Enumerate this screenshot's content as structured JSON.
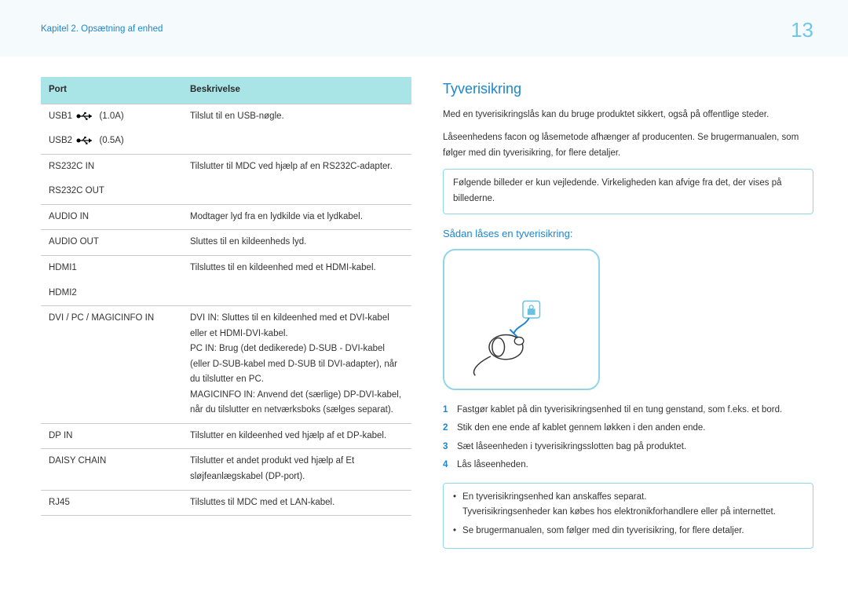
{
  "header": {
    "breadcrumb": "Kapitel 2. Opsætning af enhed",
    "page_number": "13"
  },
  "table": {
    "head_port": "Port",
    "head_desc": "Beskrivelse",
    "rows": [
      {
        "port": "USB1",
        "extra": "(1.0A)",
        "desc": "Tilslut til en USB-nøgle.",
        "icon": true
      },
      {
        "port": "USB2",
        "extra": "(0.5A)",
        "desc": "",
        "noborder": true,
        "icon": true
      },
      {
        "port": "RS232C IN",
        "desc": "Tilslutter til MDC ved hjælp af en RS232C-adapter."
      },
      {
        "port": "RS232C OUT",
        "desc": "",
        "noborder": true
      },
      {
        "port": "AUDIO IN",
        "desc": "Modtager lyd fra en lydkilde via et lydkabel."
      },
      {
        "port": "AUDIO OUT",
        "desc": "Sluttes til en kildeenheds lyd."
      },
      {
        "port": "HDMI1",
        "desc": "Tilsluttes til en kildeenhed med et HDMI-kabel."
      },
      {
        "port": "HDMI2",
        "desc": "",
        "noborder": true
      },
      {
        "port": "DVI / PC / MAGICINFO IN",
        "desc": "DVI IN: Sluttes til en kildeenhed med et DVI-kabel eller et HDMI-DVI-kabel.\nPC IN: Brug (det dedikerede) D-SUB - DVI-kabel (eller D-SUB-kabel med D-SUB til DVI-adapter), når du tilslutter en PC.\nMAGICINFO IN: Anvend det (særlige) DP-DVI-kabel, når du tilslutter en netværksboks (sælges separat)."
      },
      {
        "port": "DP IN",
        "desc": "Tilslutter en kildeenhed ved hjælp af et DP-kabel."
      },
      {
        "port": "DAISY CHAIN",
        "desc": "Tilslutter et andet produkt ved hjælp af Et sløjfeanlægskabel (DP-port)."
      },
      {
        "port": "RJ45",
        "desc": "Tilsluttes til MDC med et LAN-kabel."
      }
    ]
  },
  "right": {
    "title": "Tyverisikring",
    "intro1": "Med en tyverisikringslås kan du bruge produktet sikkert, også på offentlige steder.",
    "intro2": "Låseenhedens facon og låsemetode afhænger af producenten. Se brugermanualen, som følger med din tyverisikring, for flere detaljer.",
    "note": "Følgende billeder er kun vejledende. Virkeligheden kan afvige fra det, der vises på billederne.",
    "sub_title": "Sådan låses en tyverisikring:",
    "steps": [
      "Fastgør kablet på din tyverisikringsenhed til en tung genstand, som f.eks. et bord.",
      "Stik den ene ende af kablet gennem løkken i den anden ende.",
      "Sæt låseenheden i tyverisikringsslotten bag på produktet.",
      "Lås låseenheden."
    ],
    "bullets": [
      "En tyverisikringsenhed kan anskaffes separat.",
      "Se brugermanualen, som følger med din tyverisikring, for flere detaljer."
    ],
    "bullet_sub": "Tyverisikringsenheder kan købes hos elektronikforhandlere eller på internettet."
  }
}
